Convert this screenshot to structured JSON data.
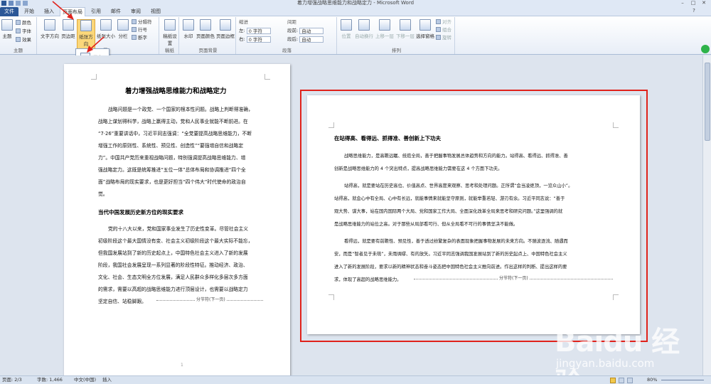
{
  "window": {
    "title": "着力增强战略思维能力和战略定力 - Microsoft Word",
    "minimize": "–",
    "maximize": "□",
    "close": "✕"
  },
  "tabs": [
    {
      "label": "文件"
    },
    {
      "label": "开始"
    },
    {
      "label": "插入"
    },
    {
      "label": "页面布局"
    },
    {
      "label": "引用"
    },
    {
      "label": "邮件"
    },
    {
      "label": "审阅"
    },
    {
      "label": "视图"
    }
  ],
  "ribbon": {
    "groups": {
      "theme": {
        "label": "主题",
        "theme_btn": "主题",
        "colors": "颜色",
        "fonts": "字体",
        "effects": "效果"
      },
      "page_setup": {
        "label": "页面设置",
        "text_direction": "文字方向",
        "margins": "页边距",
        "orientation": "纸张方向",
        "size": "纸张大小",
        "columns": "分栏",
        "breaks": "分隔符",
        "line_numbers": "行号",
        "hyphenation": "断字"
      },
      "draft": {
        "label": "稿纸",
        "draft_btn": "稿纸设置"
      },
      "page_background": {
        "label": "页面背景",
        "watermark": "水印",
        "page_color": "页面颜色",
        "page_borders": "页面边框"
      },
      "paragraph": {
        "label": "段落",
        "indent_title": "缩进",
        "spacing_title": "间距",
        "indent_left_label": "左:",
        "indent_left_value": "0 字符",
        "indent_right_label": "右:",
        "indent_right_value": "0 字符",
        "spacing_before_label": "段前:",
        "spacing_before_value": "自动",
        "spacing_after_label": "段后:",
        "spacing_after_value": "自动"
      },
      "arrange": {
        "label": "排列",
        "position": "位置",
        "wrap": "自动换行",
        "forward": "上移一层",
        "backward": "下移一层",
        "selection_pane": "选择窗格",
        "align": "对齐",
        "group": "组合",
        "rotate": "旋转"
      }
    }
  },
  "dropdown": {
    "portrait": "纵向",
    "landscape": "横向"
  },
  "page1": {
    "title": "着力增强战略思维能力和战略定力",
    "para1": [
      "战略问题是一个政党、一个国家的根本性问题。战略上判断得准确，",
      "战略上谋划得科学，战略上赢得主动，党和人民事业就能不断前进。在",
      "“7·26”重要讲话中，习近平同志强调：“全党要提高战略思维能力，不断",
      "增强工作的原则性、系统性、预见性、创造性”“要强增自信和战略定",
      "力”。中国共产党历来重视战略问题，特别强调提高战略思维能力、增",
      "强战略定力。这既是统筹推进“五位一体”总体布局和协调推进“四个全",
      "面”战略布局的现实要求，也是更好担当“四个伟大”时代使命的政治自",
      "觉。"
    ],
    "heading2": "当代中国发展历史新方位的现实要求",
    "para2": [
      "党的十八大以来，党和国家事业发生了历史性变革。尽管社会主义",
      "初级阶段这个最大国情没有变、社会主义初级阶段这个最大实际不能忘，",
      "但我国发展站到了新的历史起点上，中国特色社会主义进入了新的发展",
      "阶段，我国社会发展呈现一系列显著的阶段性特征。推动经济、政治、",
      "文化、社会、生态文明全方位发展，满足人民群众多样化多层次多方面",
      "的需求，需要以高超的战略思维能力进行顶层设计，也需要以战略定力",
      "坚定自信、站稳脚跟。"
    ],
    "section_break": "分节符(下一页)",
    "footer_mark": "1"
  },
  "page2": {
    "heading": "在站得高、看得远、抓得准、善创新上下功夫",
    "para1": [
      "战略思维能力，是高瞻远瞩、统揽全局，善于把握事物发展总体趋势和方向的能力。站得高、看得远、抓得准、善",
      "创新是战略思维能力的 4 个突出特点，提高战略思维能力需要在这 4 个方面下功夫。"
    ],
    "para2": [
      "站得高，就是要站在历史高位、价值高点、世界高度来观察、思考和处理问题。正所谓“会当凌绝顶，一览众山小”。",
      "站得高，就会心中有全局、心中有长远，就能事情来就能坚守原则，就能举重若轻、游刃有余。习近平同志说：“善于",
      "观大势、谋大事，站在国内国际两个大局、党和国家工作大局、全面深化改革全局来思考和研究问题。”这里强调的就",
      "是战略思维能力的站位之高。对于那些从局部看可行、但从全局看不可行的事情坚决不能做。"
    ],
    "para3": [
      "看得远，就是要有前瞻性、预见性，善于透过纷繁复杂的表面现象把握事物发展的未来方向。不随波逐流、随遇而",
      "安，而是“智者见于未萌”，未雨绸缪、有的放矢。习近平同志强调我国发展站到了新的历史起点上、中国特色社会主义",
      "进入了新的发展阶段，要求以新的精神状态和奋斗姿态把中国特色社会主义推向前进。作出这样的判断、提出这样的要",
      "求，体现了高超的战略思维能力。"
    ],
    "section_break": "分节符(下一页)"
  },
  "statusbar": {
    "page": "页面: 2/3",
    "words": "字数: 1,466",
    "language": "中文(中国)",
    "mode": "插入",
    "zoom": "80%"
  },
  "watermark": {
    "brand": "Baidu 经验",
    "url": "jingyan.baidu.com"
  },
  "colors": {
    "accent": "#2b5797",
    "highlight_frame": "#e0221b",
    "arrow": "#e0221b"
  }
}
